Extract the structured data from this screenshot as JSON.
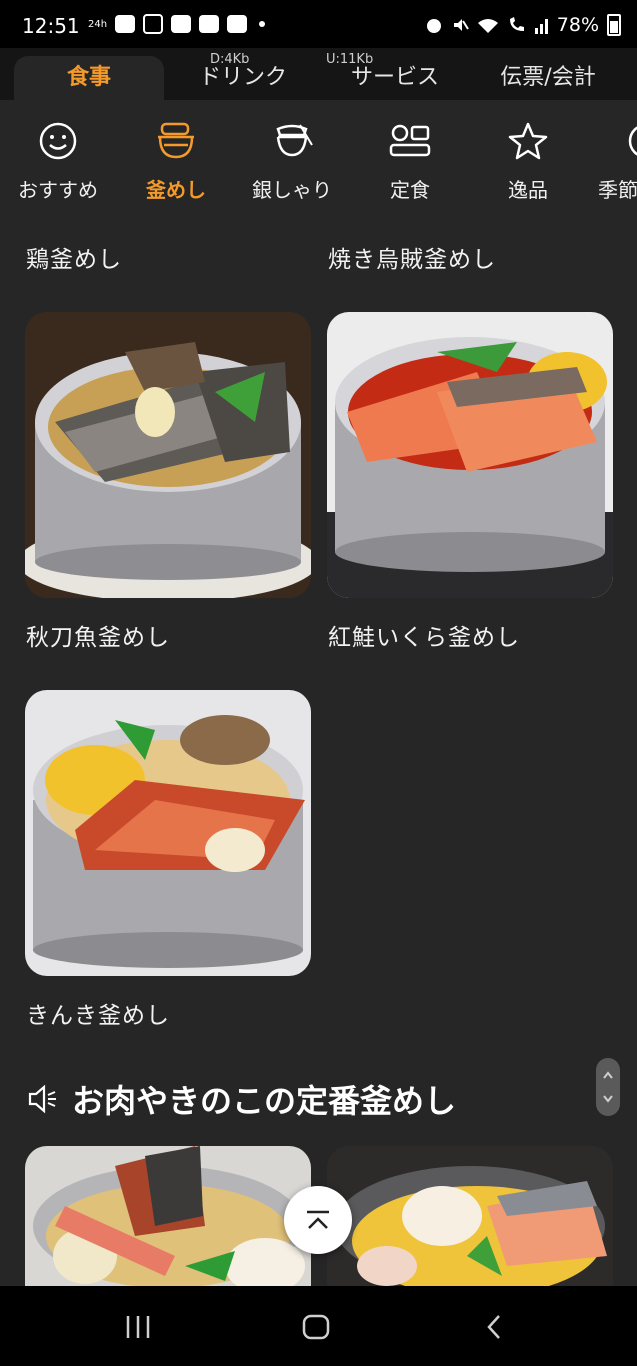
{
  "status_bar": {
    "time": "12:51",
    "hours_badge": "24h",
    "battery": "78%",
    "icons": [
      "youtube-icon",
      "instagram-icon",
      "app-icon",
      "app-icon",
      "app-icon",
      "alarm-icon",
      "mute-icon",
      "wifi-icon",
      "call-icon",
      "signal-icon",
      "battery-icon"
    ]
  },
  "net": {
    "down": "D:4Kb",
    "up": "U:11Kb"
  },
  "tabs": [
    {
      "label": "食事",
      "active": true
    },
    {
      "label": "ドリンク",
      "active": false
    },
    {
      "label": "サービス",
      "active": false
    },
    {
      "label": "伝票/会計",
      "active": false
    }
  ],
  "categories": [
    {
      "label": "おすすめ",
      "icon": "smile-icon",
      "active": false
    },
    {
      "label": "釜めし",
      "icon": "kamameshi-pot-icon",
      "active": true
    },
    {
      "label": "銀しゃり",
      "icon": "rice-bowl-icon",
      "active": false
    },
    {
      "label": "定食",
      "icon": "set-meal-icon",
      "active": false
    },
    {
      "label": "逸品",
      "icon": "star-icon",
      "active": false
    },
    {
      "label": "季節",
      "icon": "seasonal-icon",
      "active": false
    }
  ],
  "items": [
    {
      "name": "鶏釜めし"
    },
    {
      "name": "焼き烏賊釜めし"
    },
    {
      "name": "秋刀魚釜めし"
    },
    {
      "name": "紅鮭いくら釜めし"
    },
    {
      "name": "きんき釜めし"
    }
  ],
  "section": {
    "title": "お肉やきのこの定番釜めし",
    "icon": "speaker-icon"
  },
  "colors": {
    "accent": "#f39a2b",
    "background": "#262626",
    "tab_bar": "#151515"
  }
}
